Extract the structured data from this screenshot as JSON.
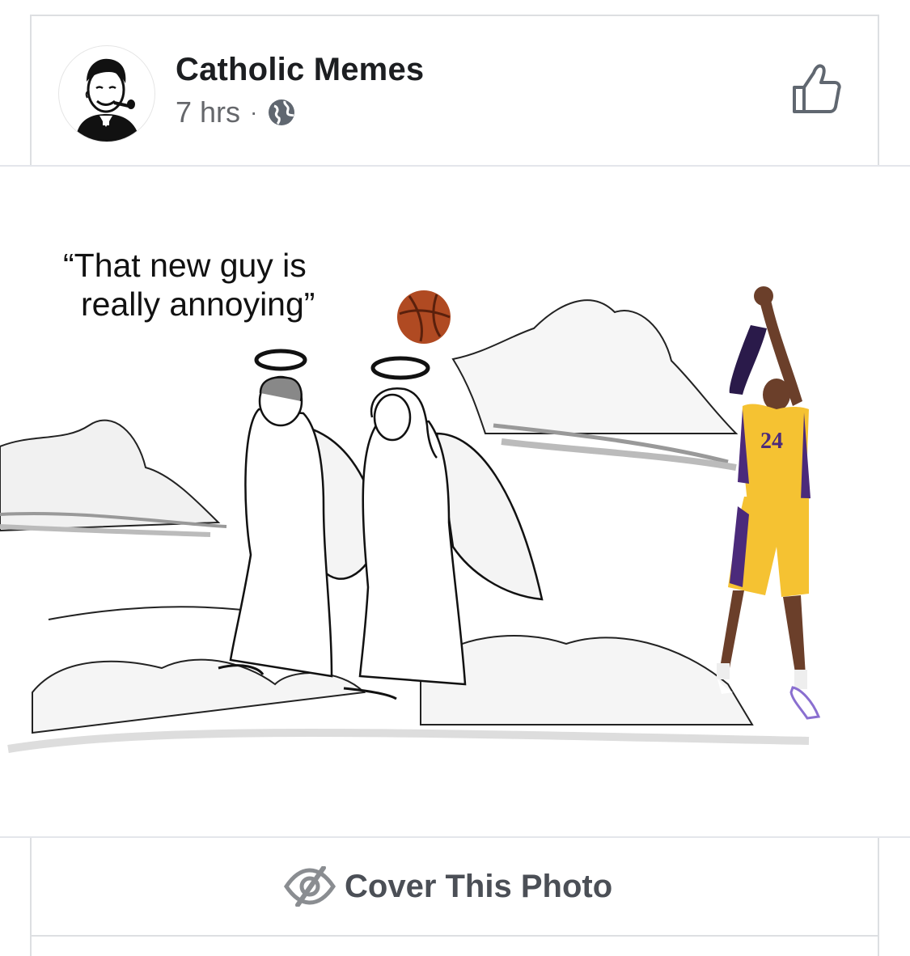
{
  "post": {
    "page_name": "Catholic Memes",
    "time": "7 hrs",
    "separator": "·",
    "privacy_icon": "globe-icon",
    "like_icon": "thumbs-up-icon"
  },
  "photo": {
    "caption_line1": "“That new guy is",
    "caption_line2": "really annoying”",
    "jersey_number": "24"
  },
  "footer": {
    "cover_label": "Cover This Photo",
    "cover_icon": "eye-slash-icon"
  },
  "colors": {
    "text_primary": "#1c1e21",
    "text_secondary": "#65676b",
    "icon_gray": "#606770",
    "jersey_gold": "#f5c232",
    "jersey_purple": "#4b2a7b"
  }
}
